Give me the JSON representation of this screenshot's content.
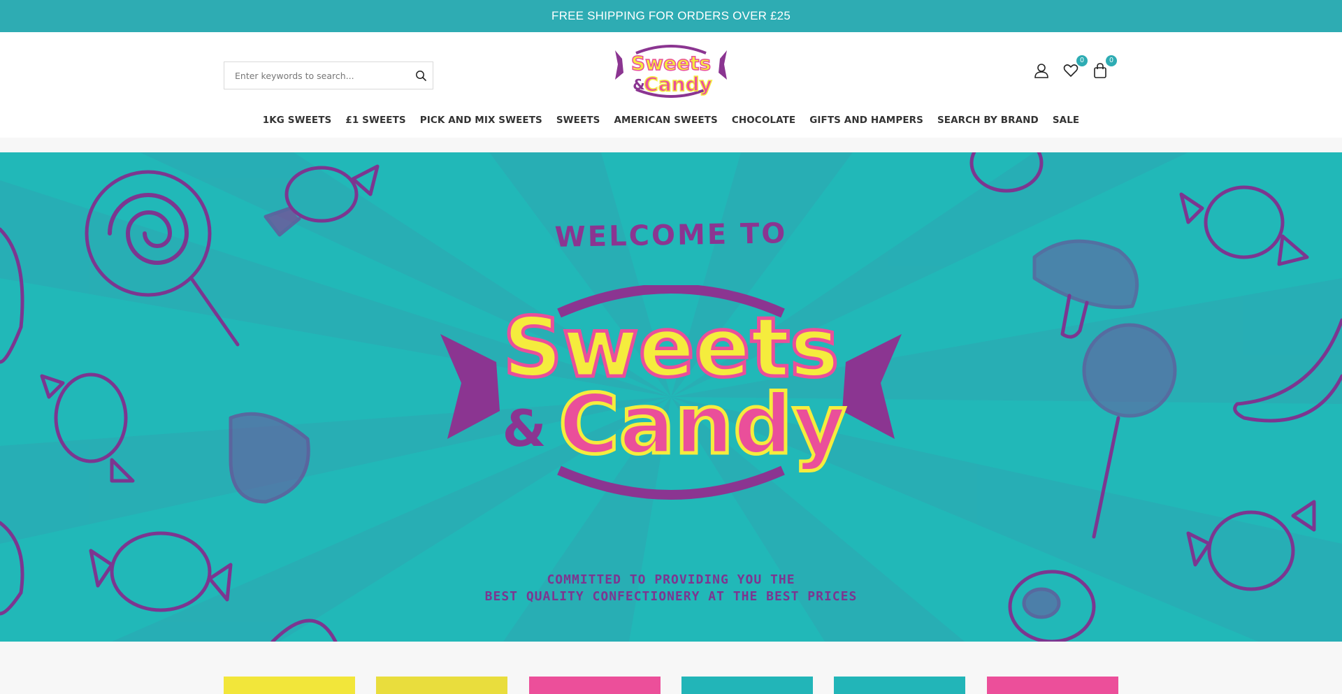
{
  "topbar": {
    "text": "FREE SHIPPING FOR ORDERS OVER £25"
  },
  "search": {
    "placeholder": "Enter keywords to search..."
  },
  "logo": {
    "line1": "Sweets",
    "amp": "&",
    "line2": "Candy"
  },
  "header_actions": {
    "account_icon": "user-icon",
    "wishlist_icon": "heart-icon",
    "wishlist_count": "0",
    "cart_icon": "shopping-bag-icon",
    "cart_count": "0"
  },
  "nav": {
    "items": [
      {
        "label": "1KG SWEETS"
      },
      {
        "label": "£1 SWEETS"
      },
      {
        "label": "PICK AND MIX SWEETS"
      },
      {
        "label": "SWEETS"
      },
      {
        "label": "AMERICAN SWEETS"
      },
      {
        "label": "CHOCOLATE"
      },
      {
        "label": "GIFTS AND HAMPERS"
      },
      {
        "label": "SEARCH BY BRAND"
      },
      {
        "label": "SALE"
      }
    ]
  },
  "hero": {
    "welcome": "WELCOME TO",
    "logo_line1": "Sweets",
    "logo_amp": "&",
    "logo_line2": "Candy",
    "tagline_line1": "COMMITTED TO PROVIDING YOU THE",
    "tagline_line2": "BEST QUALITY CONFECTIONERY AT THE BEST PRICES"
  },
  "colors": {
    "teal": "#2eacb3",
    "hero_teal": "#21b8b8",
    "purple": "#8b3591",
    "yellow": "#f5ec3d",
    "pink": "#ea4f9a",
    "category_tiles": [
      "#f2e63a",
      "#e9dd3d",
      "#ec4f9a",
      "#22b5b8",
      "#22b5b8",
      "#ec4f9a"
    ]
  }
}
